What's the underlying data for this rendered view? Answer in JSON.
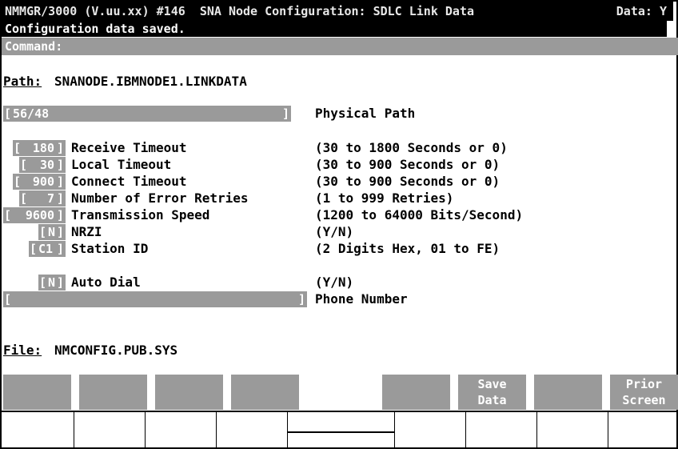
{
  "title_bar": {
    "title": "NMMGR/3000 (V.uu.xx) #146  SNA Node Configuration: SDLC Link Data",
    "data_indicator": "Data: Y"
  },
  "message": "Configuration data saved.",
  "command": {
    "label": "Command:",
    "value": ""
  },
  "path": {
    "label": "Path:",
    "value": "SNANODE.IBMNODE1.LINKDATA"
  },
  "physical_path": {
    "value": "56/48",
    "label": "Physical Path"
  },
  "params": [
    {
      "value": "180",
      "label": "Receive Timeout",
      "range": "(30 to 1800 Seconds or 0)"
    },
    {
      "value": "30",
      "label": "Local Timeout",
      "range": "(30 to 900 Seconds or 0)"
    },
    {
      "value": "900",
      "label": "Connect Timeout",
      "range": "(30 to 900 Seconds or 0)"
    },
    {
      "value": "7",
      "label": "Number of Error Retries",
      "range": "(1 to 999 Retries)"
    },
    {
      "value": "9600",
      "label": "Transmission Speed",
      "range": "(1200 to 64000 Bits/Second)"
    },
    {
      "value": "N",
      "label": "NRZI",
      "range": "(Y/N)"
    },
    {
      "value": "C1",
      "label": "Station ID",
      "range": "(2 Digits Hex, 01 to FE)"
    },
    {
      "value": "N",
      "label": "Auto Dial",
      "range": "(Y/N)"
    }
  ],
  "phone_number": {
    "value": "",
    "label": "Phone Number"
  },
  "file": {
    "label": "File:",
    "value": "NMCONFIG.PUB.SYS"
  },
  "function_keys": [
    "",
    "",
    "",
    "",
    "",
    "",
    "Save\nData",
    "",
    "Prior\nScreen"
  ]
}
